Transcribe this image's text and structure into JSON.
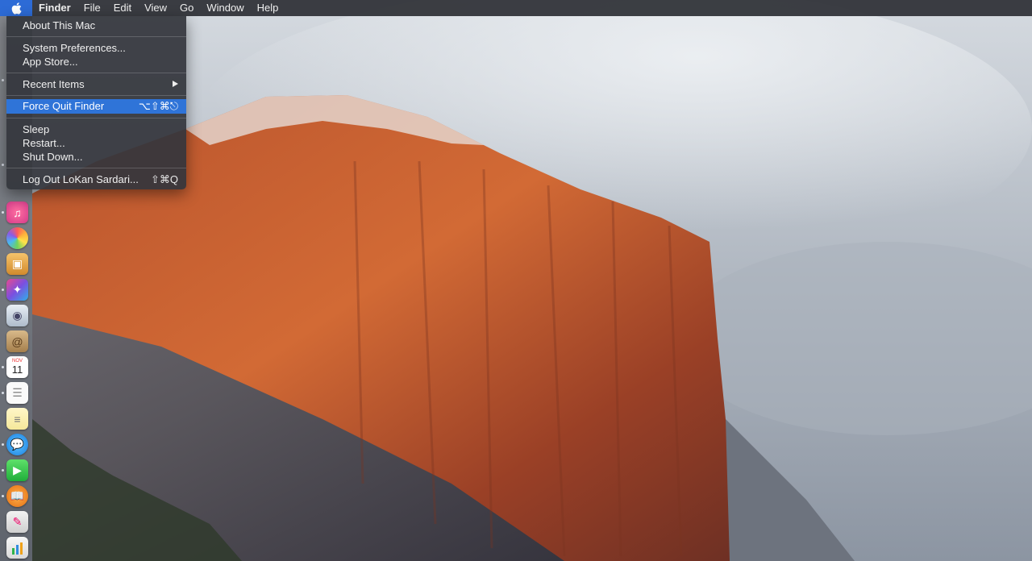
{
  "menubar": {
    "app_name": "Finder",
    "items": [
      "File",
      "Edit",
      "View",
      "Go",
      "Window",
      "Help"
    ]
  },
  "apple_menu": {
    "about": "About This Mac",
    "system_prefs": "System Preferences...",
    "app_store": "App Store...",
    "recent_items": "Recent Items",
    "force_quit": "Force Quit Finder",
    "force_quit_shortcut": "⌥⇧⌘⎋",
    "sleep": "Sleep",
    "restart": "Restart...",
    "shut_down": "Shut Down...",
    "log_out": "Log Out LoKan Sardari...",
    "log_out_shortcut": "⇧⌘Q"
  },
  "dock": {
    "calendar_month": "NOV",
    "calendar_day": "11"
  },
  "colors": {
    "highlight": "#2f74d8",
    "menubar": "#2d2f34"
  }
}
